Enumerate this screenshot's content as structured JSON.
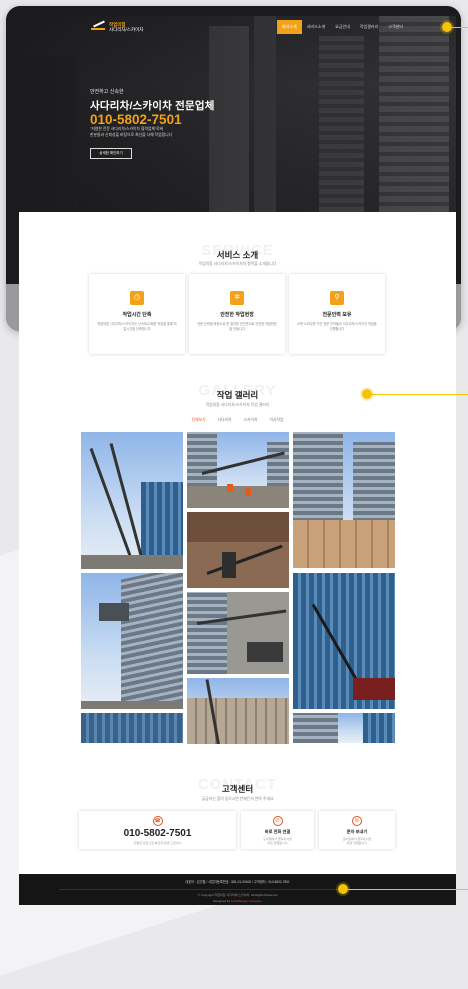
{
  "header": {
    "logo_line1": "작업의힘",
    "logo_line2": "사다리차/스카이차",
    "menu": [
      "회사소개",
      "서비스소개",
      "요금안내",
      "작업갤러리",
      "고객센터"
    ],
    "active_menu_index": 0
  },
  "hero": {
    "kicker": "안전하고 신속한",
    "title": "사다리차/스카이차 전문업체",
    "phone": "010-5802-7501",
    "desc_line1": "\"저렴한 전문 사다리차/스카이차 협력업체\"로써",
    "desc_line2": "한분들과 신뢰성을 바탕으로 최선을 다해 작업합니다",
    "button": "상세한 확인하기"
  },
  "services": {
    "bg_word": "SERVICE",
    "title": "서비스 소개",
    "subtitle": "작업의힘 사다리차/스카이차의 항목을 소개합니다",
    "items": [
      {
        "icon": "clock-icon",
        "title": "작업시간 단축",
        "desc": "작업의힘 사다리차/스카이차는 신속하고 빠른 작업을 통해 작업시간을 단축합니다"
      },
      {
        "icon": "gear-icon",
        "title": "안전한 작업현장",
        "desc": "전문 인력을 바탕으로 한 철저한 안전관리로 안전한 작업현장을 만듭니다"
      },
      {
        "icon": "search-icon",
        "title": "전문인력 보유",
        "desc": "오랜 노하우를 가진 전문 인력들이 사다리차/스카이차 작업을 진행합니다"
      }
    ]
  },
  "gallery": {
    "bg_word": "GALLERY",
    "title": "작업 갤러리",
    "subtitle": "작업의힘 사다리차/스카이차 작업 갤러리",
    "tabs": [
      "전체보기",
      "사다리차",
      "스카이차",
      "이사작업"
    ],
    "active_tab_index": 0
  },
  "contact": {
    "bg_word": "CONTACT",
    "title": "고객센터",
    "subtitle": "궁금하신 점이 있으시면 언제든지 연락 주세요",
    "phone": "010-5802-7501",
    "phone_desc": "친절한 상담으로 빠르게 답변 드립니다",
    "call_title": "바로 전화 연결",
    "call_desc_line1": "모바일에서 클릭하시면",
    "call_desc_line2": "바로 연결됩니다",
    "sms_title": "문자 보내기",
    "sms_desc_line1": "모바일에서 클릭하시면",
    "sms_desc_line2": "바로 연결됩니다"
  },
  "footer": {
    "info": "대표자 : 김인철 / 사업자등록번호 : 581-01-00000 / 고객센터 : 010-5802-7501",
    "copyright": "© Copyright 작업의힘 사다리차/스카이차. All Rights Reserved",
    "designed_by_label": "Designed by",
    "designed_by": "SmithDesign Company"
  },
  "colors": {
    "accent": "#f2a21a",
    "highlight": "#e2531f",
    "callout": "#f5c400"
  }
}
